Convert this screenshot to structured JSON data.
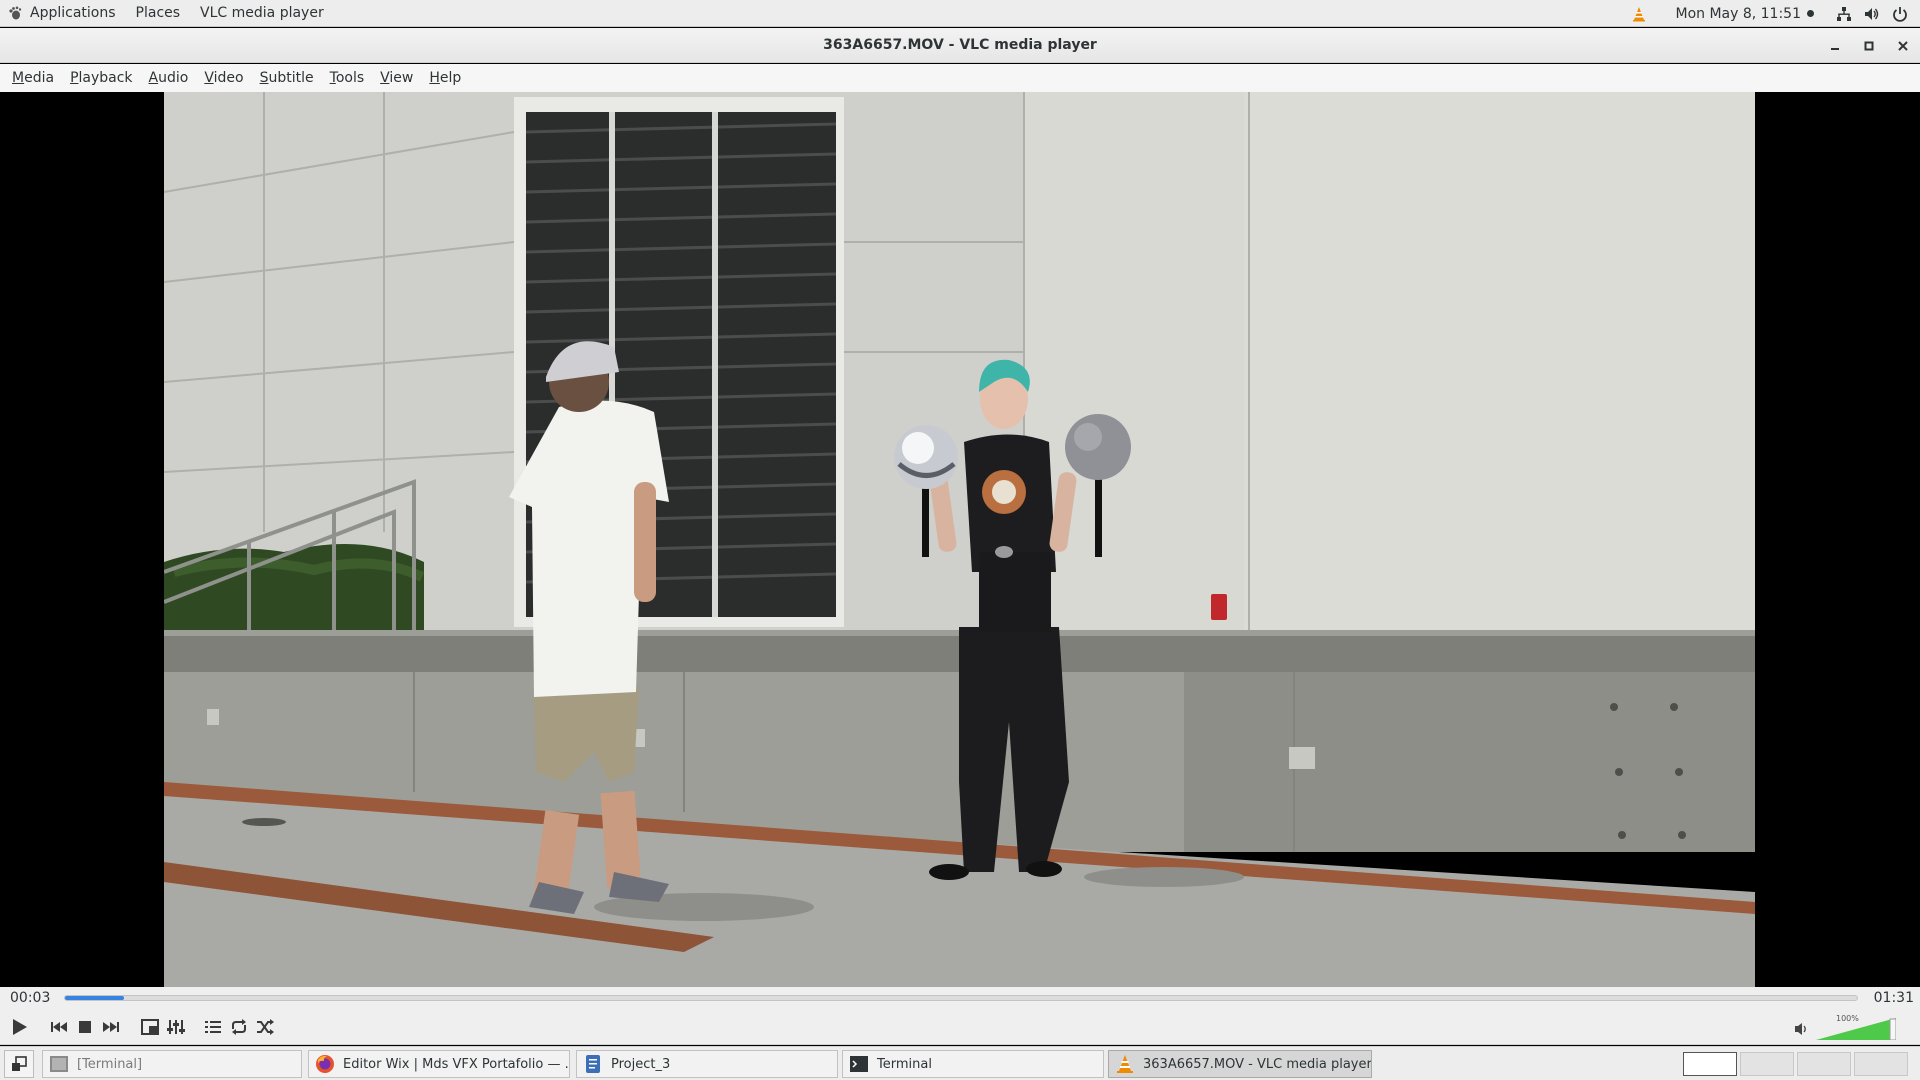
{
  "top_panel": {
    "applications": "Applications",
    "places": "Places",
    "app_name": "VLC media player",
    "clock": "Mon May  8, 11:51"
  },
  "window": {
    "title": "363A6657.MOV - VLC media player"
  },
  "menubar": {
    "items": [
      {
        "mnemonic": "M",
        "rest": "edia"
      },
      {
        "mnemonic": "P",
        "rest": "layback"
      },
      {
        "mnemonic": "A",
        "rest": "udio"
      },
      {
        "mnemonic": "V",
        "rest": "ideo"
      },
      {
        "mnemonic": "S",
        "rest": "ubtitle"
      },
      {
        "mnemonic": "T",
        "rest": "ools"
      },
      {
        "mnemonic": "V",
        "rest": "iew"
      },
      {
        "mnemonic": "H",
        "rest": "elp"
      }
    ]
  },
  "player": {
    "elapsed": "00:03",
    "duration": "01:31",
    "progress_fraction": 0.033,
    "volume_label": "100%",
    "volume_fraction": 1.0
  },
  "taskbar": {
    "tasks": [
      {
        "label": "[Terminal]",
        "icon": "terminal-icon"
      },
      {
        "label": "Editor Wix | Mds VFX Portafolio — ...",
        "icon": "firefox-icon"
      },
      {
        "label": "Project_3",
        "icon": "document-icon"
      },
      {
        "label": "Terminal",
        "icon": "terminal-icon"
      },
      {
        "label": "363A6657.MOV - VLC media player",
        "icon": "vlc-cone-icon"
      }
    ],
    "workspaces": 4,
    "current_workspace": 1
  },
  "colors": {
    "accent": "#3584e4",
    "vlc_orange": "#f08a00",
    "panel_bg": "#ededed"
  }
}
